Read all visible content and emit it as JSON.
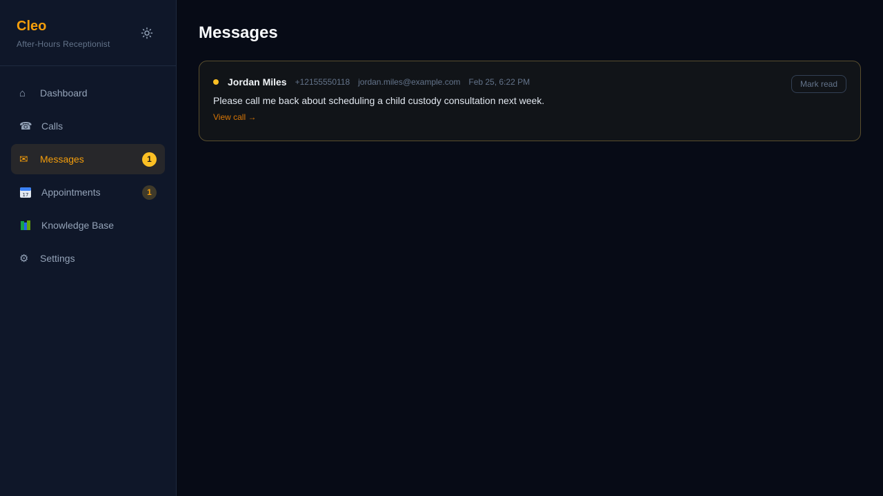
{
  "brand": {
    "name": "Cleo",
    "subtitle": "After-Hours Receptionist"
  },
  "sidebar": {
    "items": [
      {
        "label": "Dashboard",
        "icon": "home-icon"
      },
      {
        "label": "Calls",
        "icon": "phone-icon"
      },
      {
        "label": "Messages",
        "icon": "envelope-icon",
        "badge": "1",
        "active": true
      },
      {
        "label": "Appointments",
        "icon": "calendar-icon",
        "badge": "1"
      },
      {
        "label": "Knowledge Base",
        "icon": "books-icon"
      },
      {
        "label": "Settings",
        "icon": "gear-icon"
      }
    ]
  },
  "main": {
    "title": "Messages",
    "messages": [
      {
        "name": "Jordan Miles",
        "phone": "+12155550118",
        "email": "jordan.miles@example.com",
        "time": "Feb 25, 6:22 PM",
        "body": "Please call me back about scheduling a child custody consultation next week.",
        "view_call": "View call →",
        "mark_read": "Mark read",
        "unread": true
      }
    ]
  },
  "colors": {
    "accent": "#f59e0b",
    "badge": "#fbbf24",
    "background": "#070b16",
    "sidebar": "#0f1729"
  }
}
